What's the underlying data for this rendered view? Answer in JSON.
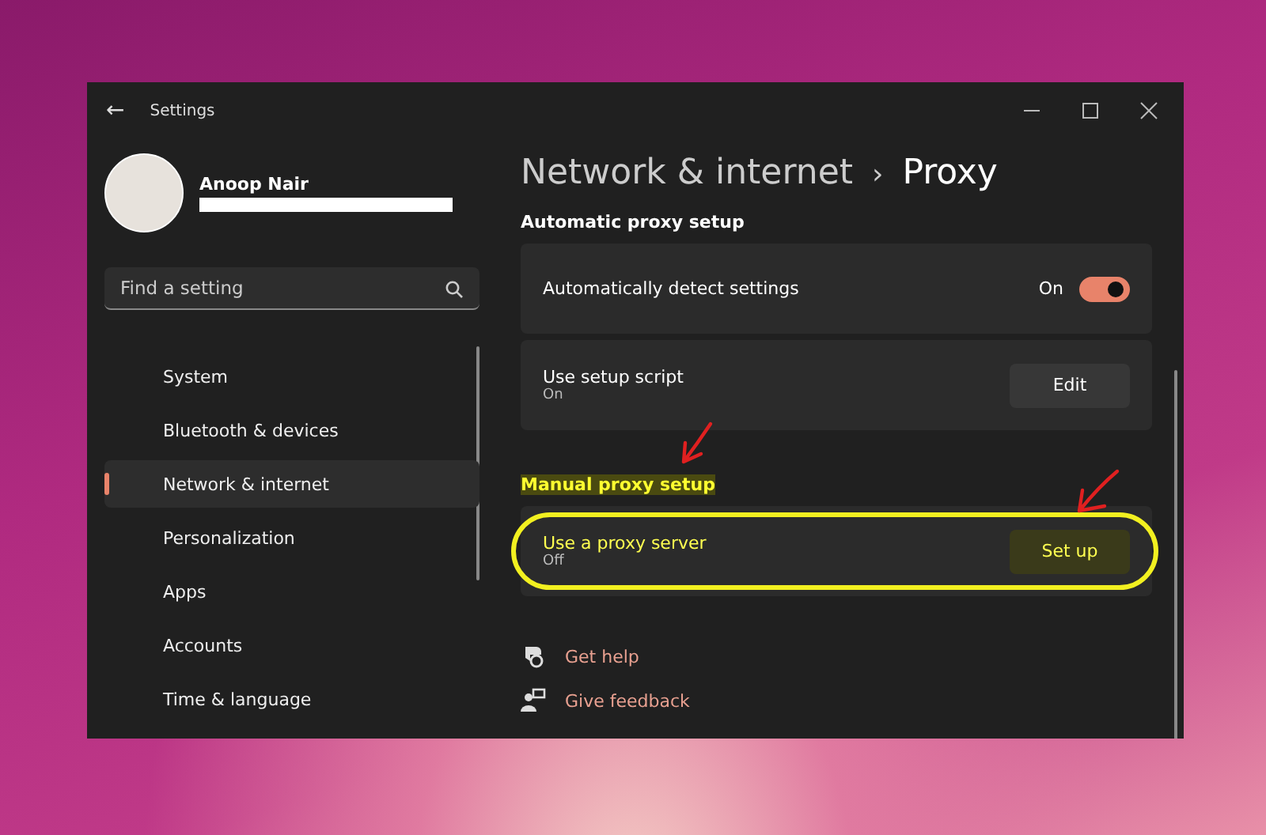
{
  "window": {
    "title": "Settings",
    "back_glyph": "←"
  },
  "account": {
    "name": "Anoop Nair"
  },
  "search": {
    "placeholder": "Find a setting"
  },
  "sidebar": {
    "items": [
      {
        "label": "System",
        "selected": false
      },
      {
        "label": "Bluetooth & devices",
        "selected": false
      },
      {
        "label": "Network & internet",
        "selected": true
      },
      {
        "label": "Personalization",
        "selected": false
      },
      {
        "label": "Apps",
        "selected": false
      },
      {
        "label": "Accounts",
        "selected": false
      },
      {
        "label": "Time & language",
        "selected": false
      }
    ]
  },
  "breadcrumb": {
    "parent": "Network & internet",
    "separator": "›",
    "current": "Proxy"
  },
  "sections": [
    {
      "title": "Automatic proxy setup",
      "highlighted": false,
      "arrow": false,
      "rows": [
        {
          "kind": "toggle",
          "label": "Automatically detect settings",
          "state_text": "On",
          "on": true,
          "circled": false,
          "arrow": false
        },
        {
          "kind": "button",
          "label": "Use setup script",
          "sub": "On",
          "button": "Edit",
          "circled": false,
          "arrow": false
        }
      ]
    },
    {
      "title": "Manual proxy setup",
      "highlighted": true,
      "arrow": true,
      "rows": [
        {
          "kind": "button",
          "label": "Use a proxy server",
          "sub": "Off",
          "button": "Set up",
          "circled": true,
          "arrow": true
        }
      ]
    }
  ],
  "links": [
    {
      "kind": "help",
      "label": "Get help"
    },
    {
      "kind": "feedback",
      "label": "Give feedback"
    }
  ]
}
